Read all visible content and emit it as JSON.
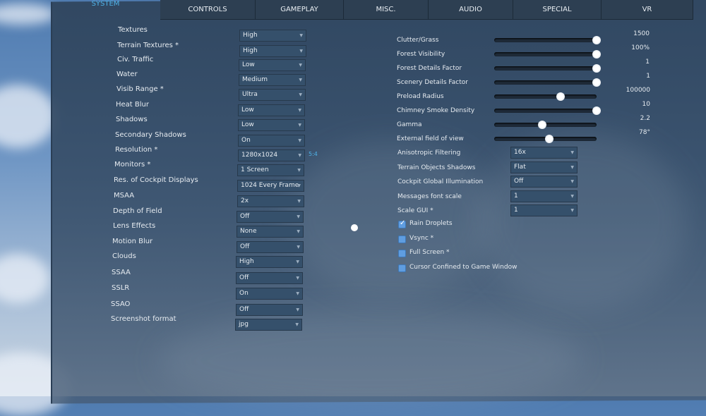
{
  "tabs": [
    "SYSTEM",
    "CONTROLS",
    "GAMEPLAY",
    "MISC.",
    "AUDIO",
    "SPECIAL",
    "VR"
  ],
  "active_tab": "SYSTEM",
  "left_settings": [
    {
      "label": "Textures",
      "value": "High"
    },
    {
      "label": "Terrain Textures *",
      "value": "High"
    },
    {
      "label": "Civ. Traffic",
      "value": "Low"
    },
    {
      "label": "Water",
      "value": "Medium"
    },
    {
      "label": "Visib Range *",
      "value": "Ultra"
    },
    {
      "label": "Heat Blur",
      "value": "Low"
    },
    {
      "label": "Shadows",
      "value": "Low"
    },
    {
      "label": "Secondary Shadows",
      "value": "On"
    },
    {
      "label": "Resolution *",
      "value": "1280x1024"
    },
    {
      "label": "Monitors *",
      "value": "1 Screen"
    },
    {
      "label": "Res. of Cockpit Displays",
      "value": "1024 Every Frame"
    },
    {
      "label": "MSAA",
      "value": "2x"
    },
    {
      "label": "Depth of Field",
      "value": "Off"
    },
    {
      "label": "Lens Effects",
      "value": "None"
    },
    {
      "label": "Motion Blur",
      "value": "Off"
    },
    {
      "label": "Clouds",
      "value": "High"
    },
    {
      "label": "SSAA",
      "value": "Off"
    },
    {
      "label": "SSLR",
      "value": "On"
    },
    {
      "label": "SSAO",
      "value": "Off"
    },
    {
      "label": "Screenshot format",
      "value": "jpg"
    }
  ],
  "aspect_ratio": "5:4",
  "sliders": [
    {
      "label": "Clutter/Grass",
      "value": "1500",
      "fraction": 1.0
    },
    {
      "label": "Forest Visibility",
      "value": "100%",
      "fraction": 1.0
    },
    {
      "label": "Forest Details Factor",
      "value": "1",
      "fraction": 1.0
    },
    {
      "label": "Scenery Details Factor",
      "value": "1",
      "fraction": 1.0
    },
    {
      "label": "Preload Radius",
      "value": "100000",
      "fraction": 0.65
    },
    {
      "label": "Chimney Smoke Density",
      "value": "10",
      "fraction": 1.0
    },
    {
      "label": "Gamma",
      "value": "2.2",
      "fraction": 0.47
    },
    {
      "label": "External field of view",
      "value": "78°",
      "fraction": 0.54
    }
  ],
  "right_dropdowns": [
    {
      "label": "Anisotropic Filtering",
      "value": "16x"
    },
    {
      "label": "Terrain Objects Shadows",
      "value": "Flat"
    },
    {
      "label": "Cockpit Global Illumination",
      "value": "Off"
    },
    {
      "label": "Messages font scale",
      "value": "1"
    },
    {
      "label": "Scale GUI *",
      "value": "1"
    }
  ],
  "checkboxes": [
    {
      "label": "Rain Droplets",
      "checked": true
    },
    {
      "label": "Vsync *",
      "checked": false
    },
    {
      "label": "Full Screen *",
      "checked": false
    },
    {
      "label": "Cursor Confined to Game Window",
      "checked": false
    }
  ],
  "colors": {
    "accent": "#4fb3e8",
    "checkbox": "#5f9de0"
  }
}
